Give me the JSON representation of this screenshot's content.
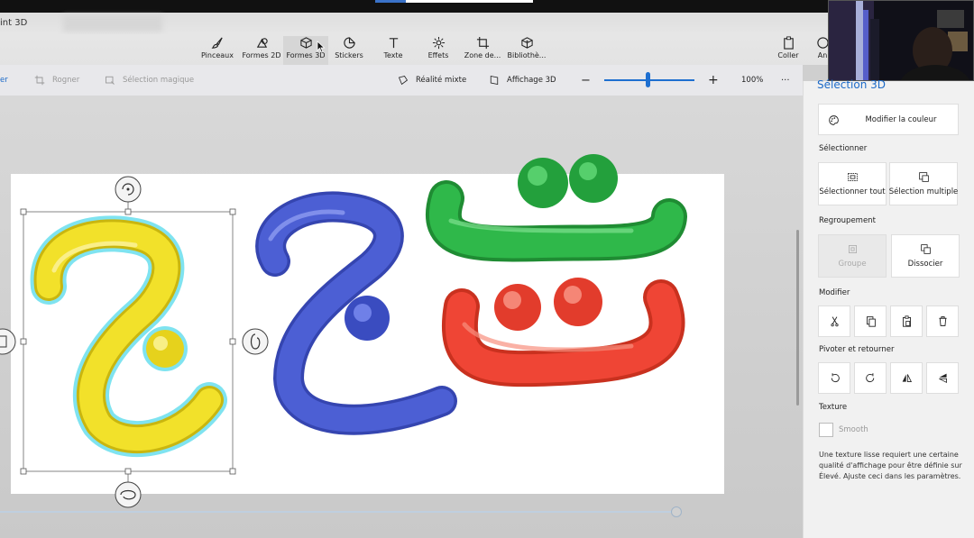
{
  "window": {
    "title": "int 3D"
  },
  "ribbon": {
    "tools": [
      {
        "id": "pinceaux",
        "label": "Pinceaux",
        "icon": "brush-icon"
      },
      {
        "id": "formes2d",
        "label": "Formes 2D",
        "icon": "shapes-2d-icon"
      },
      {
        "id": "formes3d",
        "label": "Formes 3D",
        "icon": "cube-icon",
        "selected": true
      },
      {
        "id": "stickers",
        "label": "Stickers",
        "icon": "sticker-icon"
      },
      {
        "id": "texte",
        "label": "Texte",
        "icon": "text-icon"
      },
      {
        "id": "effets",
        "label": "Effets",
        "icon": "effects-icon"
      },
      {
        "id": "zone",
        "label": "Zone de...",
        "icon": "canvas-crop-icon"
      },
      {
        "id": "biblio",
        "label": "Bibliothè...",
        "icon": "library-icon"
      }
    ],
    "right_tools": [
      {
        "id": "coller",
        "label": "Coller",
        "icon": "paste-icon"
      },
      {
        "id": "an",
        "label": "An",
        "icon": "history-icon"
      }
    ]
  },
  "subbar": {
    "left_cut": "er",
    "rogner": "Rogner",
    "selection_magique": "Sélection magique",
    "realite_mixte": "Réalité mixte",
    "affichage_3d": "Affichage 3D",
    "zoom_minus": "−",
    "zoom_plus": "+",
    "zoom_level": "100%",
    "zoom_fraction": 0.48,
    "more": "···"
  },
  "panel": {
    "title": "Sélection 3D",
    "modifier_couleur": "Modifier la couleur",
    "selectionner_heading": "Sélectionner",
    "selectionner_tout": "Sélectionner tout",
    "selection_multiple": "Sélection multiple",
    "regroupement_heading": "Regroupement",
    "groupe": "Groupe",
    "dissocier": "Dissocier",
    "modifier_heading": "Modifier",
    "pivoter_heading": "Pivoter et retourner",
    "texture_heading": "Texture",
    "smooth": "Smooth",
    "texture_note": "Une texture lisse requiert une certaine qualité d'affichage pour être définie sur Élevé. Ajuste ceci dans les paramètres."
  },
  "colors": {
    "accent": "#1e6fd0",
    "yellow": "#f2e12a",
    "blue": "#4c5fd4",
    "green": "#2fb84a",
    "red": "#ef4535",
    "selection_glow": "#7fe3f0"
  }
}
